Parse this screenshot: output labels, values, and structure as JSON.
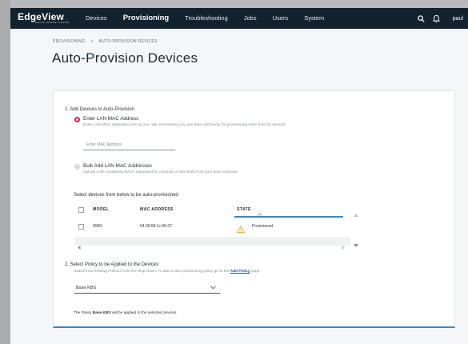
{
  "app": {
    "logo": "EdgeView",
    "logo_subtitle": "DEVICE SUPPORT CENTER"
  },
  "nav": {
    "items": [
      {
        "label": "Devices"
      },
      {
        "label": "Provisioning"
      },
      {
        "label": "Troubleshooting"
      },
      {
        "label": "Jobs"
      },
      {
        "label": "Users"
      },
      {
        "label": "System"
      }
    ],
    "active_index": 1,
    "icons": [
      "search-icon",
      "bell-icon"
    ],
    "user": "paul"
  },
  "breadcrumb": {
    "parent": "PROVISIONING",
    "separator": ">",
    "current": "AUTO-PROVISION DEVICES"
  },
  "page": {
    "title": "Auto-Provision Devices"
  },
  "section1": {
    "label": "1. Add Devices to Auto-Provision",
    "option_mac": {
      "title": "Enter LAN MAC Address",
      "description": "Enter LAN MAC addresses one by one. We recommend you use Bulk Add below for provisioning more than 10 devices.",
      "selected": true
    },
    "mac_input": {
      "placeholder": "Enter MAC Address",
      "value": ""
    },
    "option_bulk": {
      "title": "Bulk Add LAN MAC Addresses",
      "description": "Upload a file containing MACs separated by commas or new lines from your host computer.",
      "selected": false
    },
    "table_label": "Select devices from below to be auto-provisioned",
    "table": {
      "columns": [
        "MODEL",
        "MAC ADDRESS",
        "STATE"
      ],
      "sort_indicator": "^",
      "rows": [
        {
          "model": "6000",
          "mac": "54:39:68:1c:00:07",
          "state": "Provisioned",
          "state_icon": "warning-icon"
        }
      ]
    }
  },
  "section2": {
    "label": "2. Select Policy to be Applied to the Devices",
    "description_before": "Select from existing Policies from the drop-down. To add a new provisioning policy go to the",
    "link": "Add Policy",
    "description_after": "page.",
    "selected_policy": "Base KBS",
    "note_before": "The Policy",
    "note_policy": "Base KBS",
    "note_after": "will be applied to the selected devices."
  },
  "colors": {
    "nav_bg": "#12222e",
    "accent_blue": "#3a87c6",
    "radio_selected": "#d9215b",
    "warning": "#f2b035",
    "link": "#1d4f86"
  }
}
